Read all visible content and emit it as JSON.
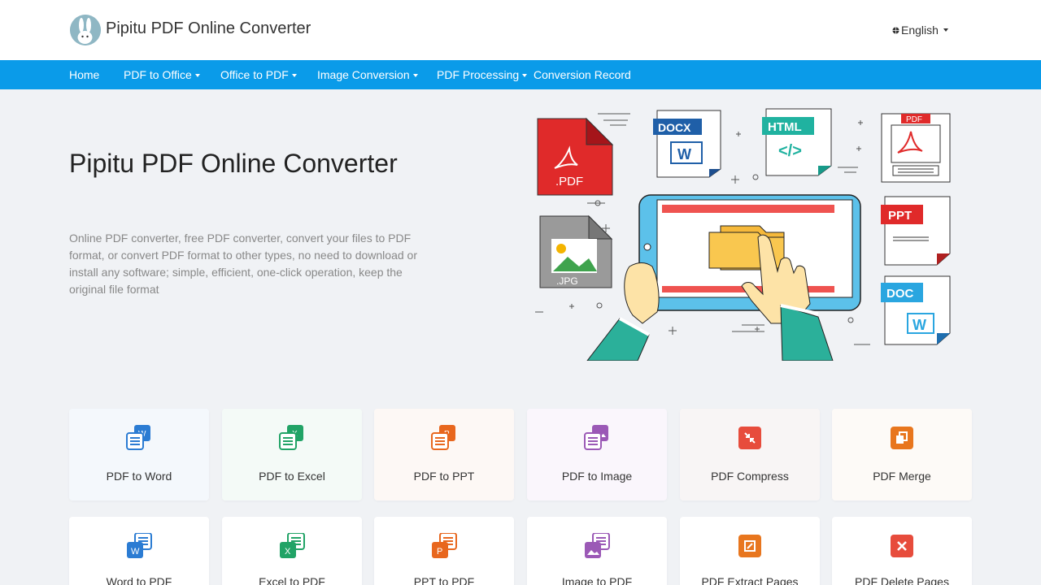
{
  "header": {
    "brand": "Pipitu PDF Online Converter",
    "language": "English"
  },
  "nav": {
    "items": [
      {
        "label": "Home",
        "dropdown": false
      },
      {
        "label": "PDF to Office",
        "dropdown": true
      },
      {
        "label": "Office to PDF",
        "dropdown": true
      },
      {
        "label": "Image Conversion",
        "dropdown": true
      },
      {
        "label": "PDF Processing",
        "dropdown": true
      },
      {
        "label": "Conversion Record",
        "dropdown": false
      }
    ]
  },
  "hero": {
    "title": "Pipitu PDF Online Converter",
    "description": "Online PDF converter, free PDF converter, convert your files to PDF format, or convert PDF format to other types, no need to download or install any software; simple, efficient, one-click operation, keep the original file format",
    "art_labels": {
      "pdf": ".PDF",
      "docx": "DOCX",
      "html": "HTML",
      "html_code": "</>",
      "pdf_small": "PDF",
      "ppt": "PPT",
      "jpg": ".JPG",
      "doc": "DOC",
      "w": "W"
    }
  },
  "tools": {
    "row1": [
      {
        "label": "PDF to Word",
        "icon": "pdf-to-word-icon",
        "color": "#2b7cd3",
        "badge": "W"
      },
      {
        "label": "PDF to Excel",
        "icon": "pdf-to-excel-icon",
        "color": "#21a366",
        "badge": "X"
      },
      {
        "label": "PDF to PPT",
        "icon": "pdf-to-ppt-icon",
        "color": "#e8671e",
        "badge": "P"
      },
      {
        "label": "PDF to Image",
        "icon": "pdf-to-image-icon",
        "color": "#9b59b6",
        "badge": ""
      },
      {
        "label": "PDF Compress",
        "icon": "pdf-compress-icon",
        "color": "#e74c3c",
        "badge": ""
      },
      {
        "label": "PDF Merge",
        "icon": "pdf-merge-icon",
        "color": "#e8761e",
        "badge": ""
      }
    ],
    "row2": [
      {
        "label": "Word to PDF",
        "icon": "word-to-pdf-icon",
        "color": "#2b7cd3",
        "badge": "W"
      },
      {
        "label": "Excel to PDF",
        "icon": "excel-to-pdf-icon",
        "color": "#21a366",
        "badge": "X"
      },
      {
        "label": "PPT to PDF",
        "icon": "ppt-to-pdf-icon",
        "color": "#e8671e",
        "badge": "P"
      },
      {
        "label": "Image to PDF",
        "icon": "image-to-pdf-icon",
        "color": "#9b59b6",
        "badge": ""
      },
      {
        "label": "PDF Extract Pages",
        "icon": "pdf-extract-pages-icon",
        "color": "#e8761e",
        "badge": ""
      },
      {
        "label": "PDF Delete Pages",
        "icon": "pdf-delete-pages-icon",
        "color": "#e74c3c",
        "badge": ""
      }
    ]
  },
  "colors": {
    "nav_bg": "#0a9be9",
    "page_bg": "#f0f2f5"
  }
}
